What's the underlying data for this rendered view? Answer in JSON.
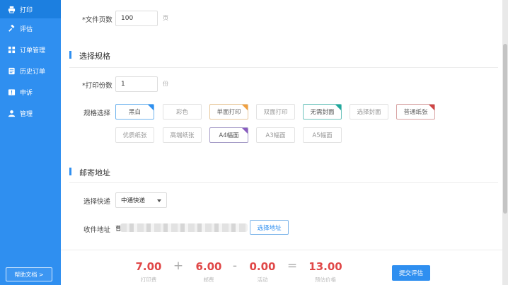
{
  "sidebar": {
    "items": [
      {
        "label": "打印",
        "icon": "printer-icon"
      },
      {
        "label": "评估",
        "icon": "gavel-icon"
      },
      {
        "label": "订单管理",
        "icon": "grid-icon"
      },
      {
        "label": "历史订单",
        "icon": "history-icon"
      },
      {
        "label": "申诉",
        "icon": "alert-icon"
      },
      {
        "label": "管理",
        "icon": "user-icon"
      }
    ],
    "help_label": "帮助文档 >"
  },
  "form": {
    "pages_label": "*文件页数",
    "pages_value": "100",
    "pages_unit": "页",
    "copies_label": "*打印份数",
    "copies_value": "1",
    "copies_unit": "份"
  },
  "spec": {
    "section_title": "选择规格",
    "row_label": "规格选择",
    "options": [
      "黑白",
      "彩色",
      "单面打印",
      "双面打印",
      "无需封面",
      "选择封面",
      "普通纸张",
      "优质纸张",
      "高端纸张",
      "A4幅面",
      "A3幅面",
      "A5幅面"
    ]
  },
  "mail": {
    "section_title": "邮寄地址",
    "courier_label": "选择快递",
    "courier_value": "中通快递",
    "address_label": "收件地址",
    "address_prefix": "曹",
    "address_button": "选择地址"
  },
  "summary": {
    "print_fee": "7.00",
    "print_fee_label": "打印费",
    "plus": "+",
    "postage": "6.00",
    "postage_label": "邮费",
    "minus": "-",
    "discount": "0.00",
    "discount_label": "活动",
    "equals": "=",
    "total": "13.00",
    "total_label": "预估价格",
    "submit_label": "提交评估"
  },
  "colors": {
    "accent": "#2f8ff0",
    "price": "#e04848"
  }
}
